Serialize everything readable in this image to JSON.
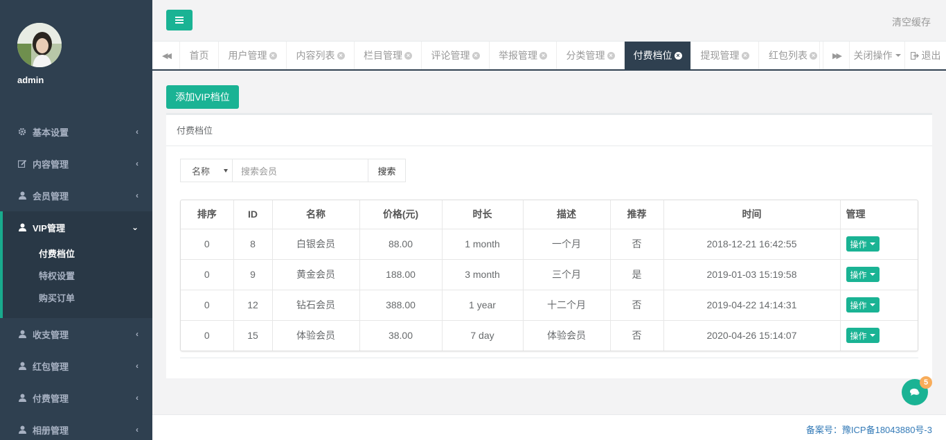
{
  "sidebar": {
    "username": "admin",
    "items": [
      {
        "label": "基本设置",
        "icon": "gear-icon"
      },
      {
        "label": "内容管理",
        "icon": "edit-icon"
      },
      {
        "label": "会员管理",
        "icon": "user-icon"
      },
      {
        "label": "VIP管理",
        "icon": "user-icon"
      },
      {
        "label": "收支管理",
        "icon": "user-icon"
      },
      {
        "label": "红包管理",
        "icon": "user-icon"
      },
      {
        "label": "付费管理",
        "icon": "user-icon"
      },
      {
        "label": "相册管理",
        "icon": "user-icon"
      }
    ],
    "vip_sub": [
      "付费档位",
      "特权设置",
      "购买订单"
    ]
  },
  "topbar": {
    "clear_cache": "清空缓存"
  },
  "tabs": [
    {
      "label": "首页",
      "closable": false
    },
    {
      "label": "用户管理",
      "closable": true
    },
    {
      "label": "内容列表",
      "closable": true
    },
    {
      "label": "栏目管理",
      "closable": true
    },
    {
      "label": "评论管理",
      "closable": true
    },
    {
      "label": "举报管理",
      "closable": true
    },
    {
      "label": "分类管理",
      "closable": true
    },
    {
      "label": "付费档位",
      "closable": true,
      "active": true
    },
    {
      "label": "提现管理",
      "closable": true
    },
    {
      "label": "红包列表",
      "closable": true
    }
  ],
  "tab_actions": {
    "close_ops": "关闭操作",
    "logout": "退出"
  },
  "main": {
    "add_button": "添加VIP档位",
    "panel_title": "付费档位",
    "search": {
      "select_value": "名称",
      "placeholder": "搜索会员",
      "button": "搜索"
    },
    "table": {
      "headers": [
        "排序",
        "ID",
        "名称",
        "价格(元)",
        "时长",
        "描述",
        "推荐",
        "时间",
        "管理"
      ],
      "rows": [
        [
          "0",
          "8",
          "白银会员",
          "88.00",
          "1 month",
          "一个月",
          "否",
          "2018-12-21 16:42:55"
        ],
        [
          "0",
          "9",
          "黄金会员",
          "188.00",
          "3 month",
          "三个月",
          "是",
          "2019-01-03 15:19:58"
        ],
        [
          "0",
          "12",
          "钻石会员",
          "388.00",
          "1 year",
          "十二个月",
          "否",
          "2019-04-22 14:14:31"
        ],
        [
          "0",
          "15",
          "体验会员",
          "38.00",
          "7 day",
          "体验会员",
          "否",
          "2020-04-26 15:14:07"
        ]
      ],
      "op_label": "操作"
    }
  },
  "footer": {
    "icp": "备案号：豫ICP备18043880号-3"
  },
  "chat": {
    "badge": "5"
  },
  "colors": {
    "sidebar": "#2f4050",
    "accent": "#1ab394",
    "badge": "#f8ac59"
  }
}
